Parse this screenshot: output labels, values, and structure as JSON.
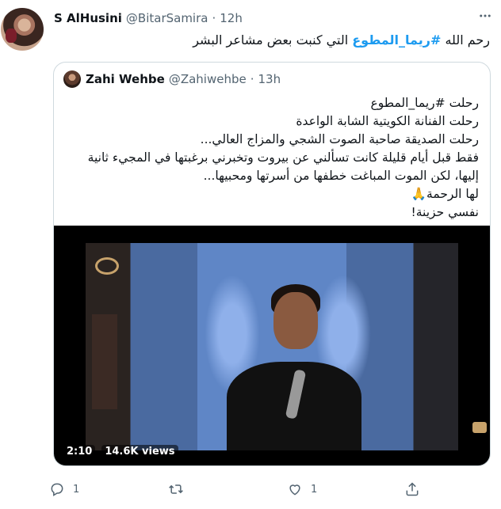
{
  "tweet": {
    "author_name": "S AlHusini",
    "handle": "@BitarSamira",
    "separator": "·",
    "time": "12h",
    "text_prefix": "رحم الله ",
    "hashtag": "#ريما_المطوع",
    "text_suffix": " التي كنبت بعض مشاعر البشر"
  },
  "quote": {
    "author_name": "Zahi Wehbe",
    "handle": "@Zahiwehbe",
    "separator": "·",
    "time": "13h",
    "lines": [
      "رحلت #ريما_المطوع",
      "رحلت الفنانة الكويتية الشابة الواعدة",
      "رحلت الصديقة صاحبة الصوت الشجي والمزاج العالي...",
      "فقط قبل أيام قليلة كانت تسألني عن بيروت وتخبرني برغبتها في المجيء ثانية",
      "إليها، لكن الموت المباغت خطفها من أسرتها ومحبيها...",
      "لها الرحمة🙏",
      "نفسي حزينة!"
    ],
    "video": {
      "duration": "2:10",
      "views": "14.6K views"
    }
  },
  "actions": {
    "reply_count": "1",
    "retweet_count": "",
    "like_count": "1"
  }
}
